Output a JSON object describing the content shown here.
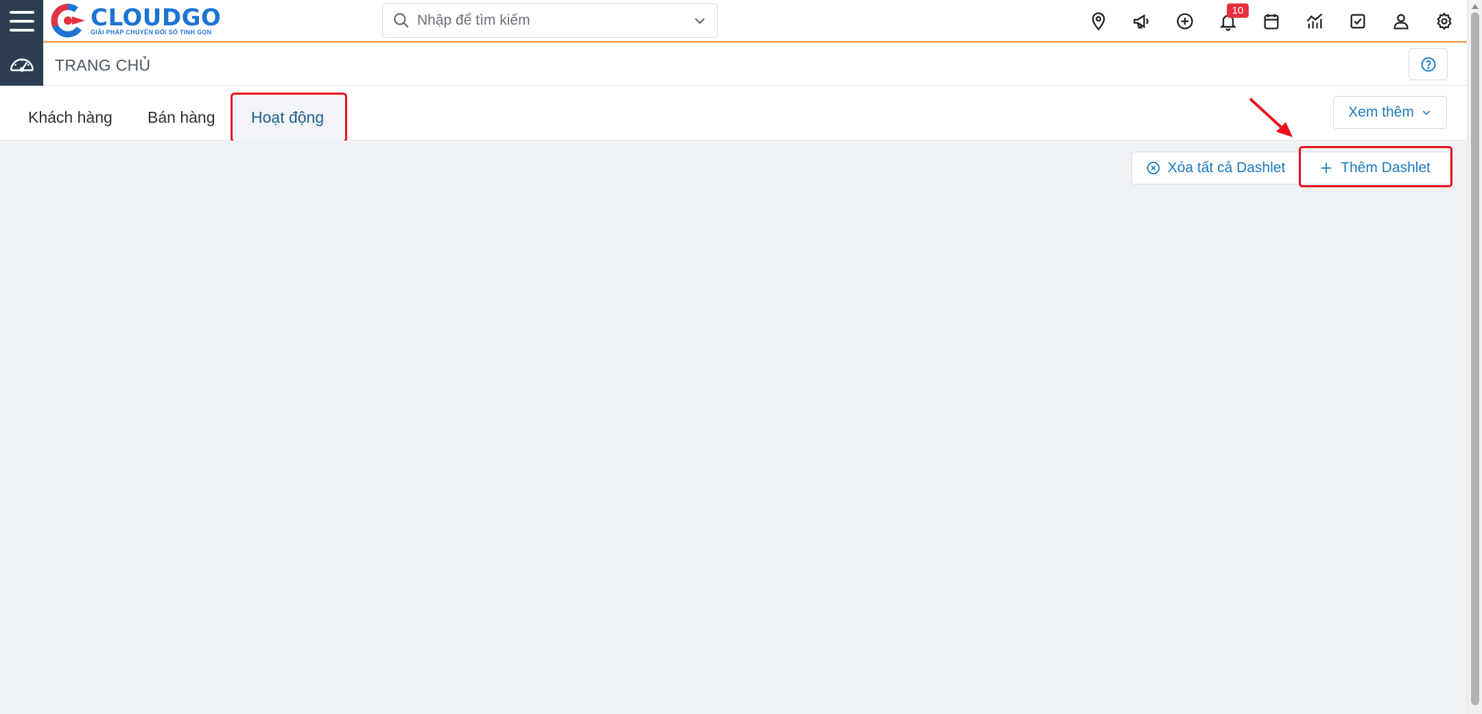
{
  "app": {
    "name": "CLOUDGO",
    "tagline": "GIẢI PHÁP CHUYỂN ĐỔI SỐ TINH GỌN"
  },
  "search": {
    "placeholder": "Nhập để tìm kiếm"
  },
  "topbar": {
    "icons": [
      "map-pin-icon",
      "megaphone-icon",
      "plus-circle-icon",
      "bell-icon",
      "calendar-icon",
      "chart-icon",
      "checkbox-icon",
      "user-icon",
      "gear-icon"
    ],
    "notification_count": "10"
  },
  "breadcrumb": {
    "title": "TRANG CHỦ"
  },
  "tabs": [
    {
      "label": "Khách hàng"
    },
    {
      "label": "Bán hàng"
    },
    {
      "label": "Hoạt động"
    }
  ],
  "active_tab": "Hoạt động",
  "more": {
    "label": "Xem thêm"
  },
  "actions": {
    "clear_label": "Xóa tất cả Dashlet",
    "add_label": "Thêm Dashlet"
  },
  "colors": {
    "accent": "#1a7ac2",
    "nav_dark": "#2c3e50",
    "highlight": "#e8101a",
    "badge": "#e8313f",
    "brand_orange": "#f28c3c"
  }
}
